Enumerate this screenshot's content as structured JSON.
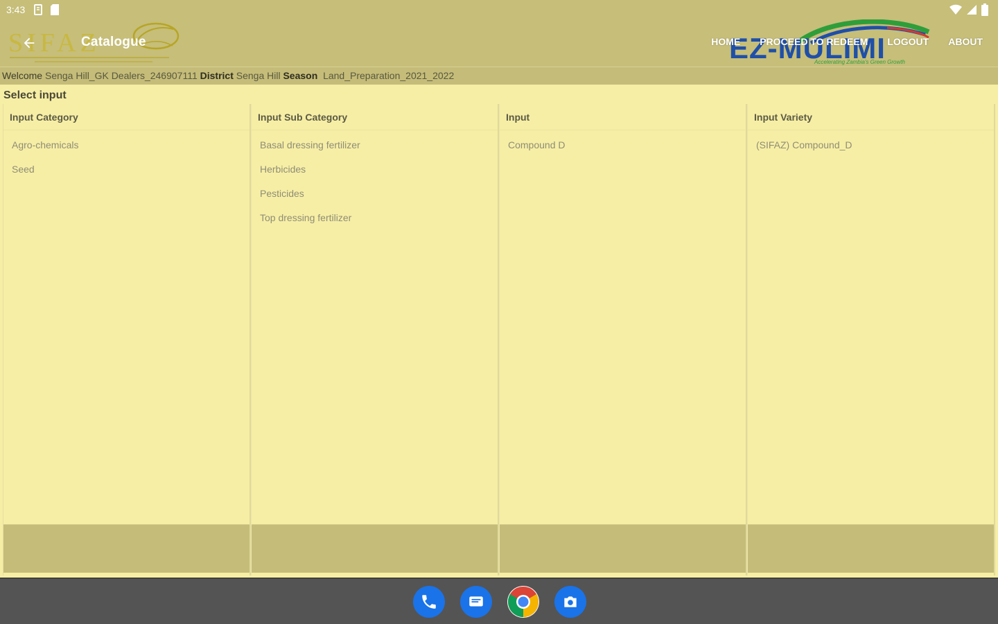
{
  "status_bar": {
    "time": "3:43",
    "left_icons": [
      "notification-icon",
      "sd-card-icon"
    ],
    "right_icons": [
      "wifi-icon",
      "signal-icon",
      "battery-icon"
    ]
  },
  "app_bar": {
    "logo_text": "SIFAZ",
    "title": "Catalogue",
    "nav": [
      {
        "label": "HOME"
      },
      {
        "label": "PROCEED TO REDEEM"
      },
      {
        "label": "LOGOUT"
      },
      {
        "label": "ABOUT"
      }
    ],
    "partner_logo_text": "EZ-MULIMI",
    "partner_tagline": "Accelerating Zambia's Green Growth"
  },
  "info_bar": {
    "welcome_label": "Welcome",
    "user": "Senga Hill_GK Dealers_246907111",
    "district_label": "District",
    "district": "Senga Hill",
    "season_label": "Season",
    "season": "Land_Preparation_2021_2022"
  },
  "content": {
    "select_label": "Select input",
    "columns": [
      {
        "header": "Input Category",
        "items": [
          "Agro-chemicals",
          "Seed"
        ]
      },
      {
        "header": "Input Sub Category",
        "items": [
          "Basal dressing fertilizer",
          "Herbicides",
          "Pesticides",
          "Top dressing fertilizer"
        ]
      },
      {
        "header": "Input",
        "items": [
          "Compound D"
        ]
      },
      {
        "header": "Input Variety",
        "items": [
          "(SIFAZ) Compound_D"
        ]
      }
    ]
  },
  "dock": {
    "apps": [
      "phone-icon",
      "messages-icon",
      "chrome-icon",
      "camera-icon"
    ]
  },
  "colors": {
    "app_bar": "#c6be79",
    "content_bg": "#f6eea5",
    "nav_bar": "#545454",
    "ezm_blue": "#1f4fa8",
    "ezm_green": "#2f9e3a"
  }
}
